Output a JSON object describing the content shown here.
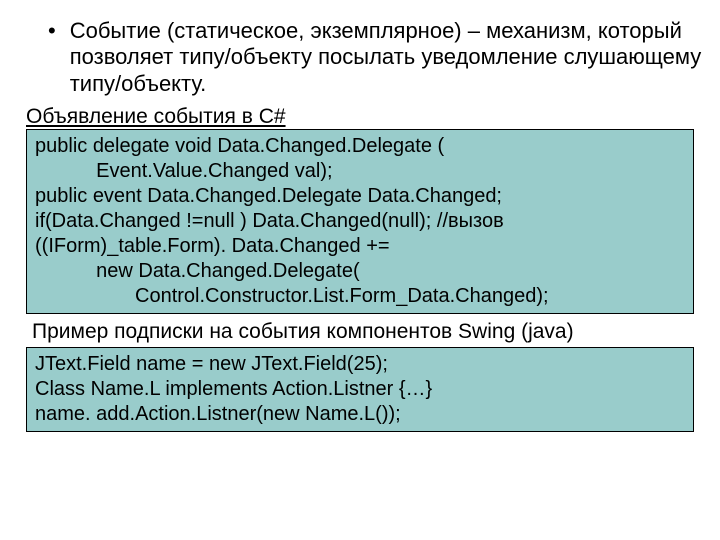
{
  "bullet": {
    "marker": "•",
    "text": "Событие (статическое, экземплярное) – механизм, который позволяет типу/объекту посылать уведомление слушающему типу/объекту."
  },
  "csharp": {
    "label": "Объявление события в C#",
    "lines": [
      "public delegate void Data.Changed.Delegate (",
      "           Event.Value.Changed val);",
      "public event Data.Changed.Delegate Data.Changed;",
      "",
      "if(Data.Changed !=null ) Data.Changed(null); //вызов",
      "((IForm)_table.Form). Data.Changed +=",
      "           new Data.Changed.Delegate(",
      "                  Control.Constructor.List.Form_Data.Changed);"
    ]
  },
  "swing": {
    "label": "Пример подписки на события компонентов Swing (java)",
    "lines": [
      "JText.Field name = new JText.Field(25);",
      "Class Name.L implements Action.Listner {…}",
      "name. add.Action.Listner(new Name.L());"
    ]
  }
}
